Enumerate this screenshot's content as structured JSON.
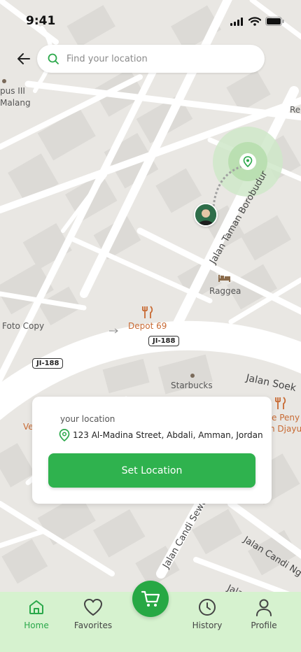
{
  "status_bar": {
    "time": "9:41"
  },
  "search": {
    "placeholder": "Find your location"
  },
  "map": {
    "labels": {
      "pus": "pus III",
      "malang": "Malang",
      "re": "Re",
      "foto_copy": "Foto Copy",
      "depot": "Depot 69",
      "raggea": "Raggea",
      "starbucks": "Starbucks",
      "ve": "Ve",
      "penyet": "e Peny",
      "djayu": "n Djayu",
      "jalan_taman": "Jalan Taman Borobudur",
      "jalan_soek": "Jalan Soek",
      "jalan_candi_sewu": "Jalan Candi Sewu",
      "jalan_candi_ng": "Jalan Candi Ng",
      "jala": "Jala",
      "ji_188_a": "JI-188",
      "ji_188_b": "JI-188"
    }
  },
  "location_card": {
    "caption": "your location",
    "address": "123 Al-Madina Street, Abdali, Amman, Jordan",
    "button_label": "Set Location"
  },
  "tabs": {
    "home": "Home",
    "favorites": "Favorites",
    "history": "History",
    "profile": "Profile"
  },
  "colors": {
    "accent": "#2fb24e",
    "tab_bar": "#d6f2cf",
    "map_bg": "#e9e7e3",
    "road": "#ffffff",
    "poi_orange": "#c86a33"
  }
}
